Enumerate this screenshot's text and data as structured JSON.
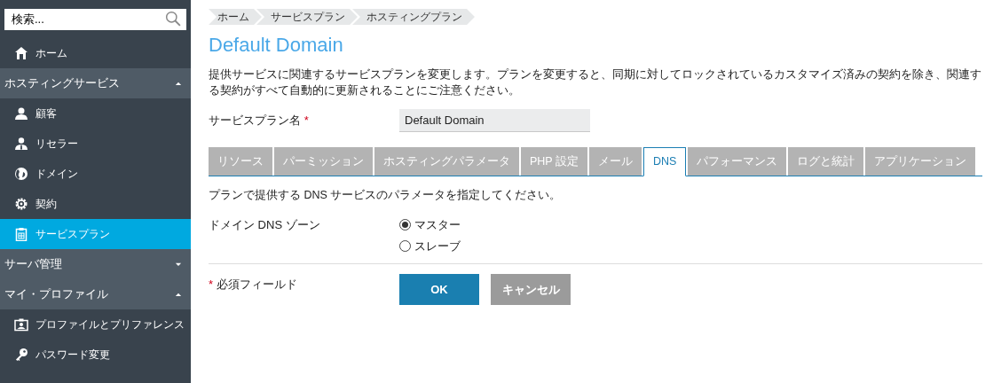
{
  "sidebar": {
    "search": {
      "placeholder": "検索..."
    },
    "items": [
      {
        "kind": "link",
        "label": "ホーム",
        "selected": false
      },
      {
        "kind": "section",
        "label": "ホスティングサービス",
        "expanded": true,
        "children": [
          {
            "kind": "link",
            "label": "顧客",
            "selected": false
          },
          {
            "kind": "link",
            "label": "リセラー",
            "selected": false
          },
          {
            "kind": "link",
            "label": "ドメイン",
            "selected": false
          },
          {
            "kind": "link",
            "label": "契約",
            "selected": false
          },
          {
            "kind": "link",
            "label": "サービスプラン",
            "selected": true
          }
        ]
      },
      {
        "kind": "section",
        "label": "サーバ管理",
        "expanded": false
      },
      {
        "kind": "section",
        "label": "マイ・プロファイル",
        "expanded": true,
        "children": [
          {
            "kind": "link",
            "label": "プロファイルとプリファレンス",
            "selected": false
          },
          {
            "kind": "link",
            "label": "パスワード変更",
            "selected": false
          }
        ]
      }
    ]
  },
  "breadcrumbs": [
    "ホーム",
    "サービスプラン",
    "ホスティングプラン"
  ],
  "title": "Default Domain",
  "description": "提供サービスに関連するサービスプランを変更します。プランを変更すると、同期に対してロックされているカスタマイズ済みの契約を除き、関連する契約がすべて自動的に更新されることにご注意ください。",
  "plan_name": {
    "label": "サービスプラン名",
    "required_mark": "*",
    "value": "Default Domain"
  },
  "tabs": [
    {
      "label": "リソース",
      "selected": false
    },
    {
      "label": "パーミッション",
      "selected": false
    },
    {
      "label": "ホスティングパラメータ",
      "selected": false
    },
    {
      "label": "PHP 設定",
      "selected": false
    },
    {
      "label": "メール",
      "selected": false
    },
    {
      "label": "DNS",
      "selected": true
    },
    {
      "label": "パフォーマンス",
      "selected": false
    },
    {
      "label": "ログと統計",
      "selected": false
    },
    {
      "label": "アプリケーション",
      "selected": false
    }
  ],
  "tab_hint": "プランで提供する DNS サービスのパラメータを指定してください。",
  "dns_zone": {
    "label": "ドメイン DNS ゾーン",
    "options": [
      {
        "label": "マスター",
        "selected": true
      },
      {
        "label": "スレーブ",
        "selected": false
      }
    ]
  },
  "required_note": {
    "mark": "*",
    "label": "必須フィールド"
  },
  "buttons": [
    {
      "kind": "primary",
      "label": "OK"
    },
    {
      "kind": "secondary",
      "label": "キャンセル"
    }
  ]
}
